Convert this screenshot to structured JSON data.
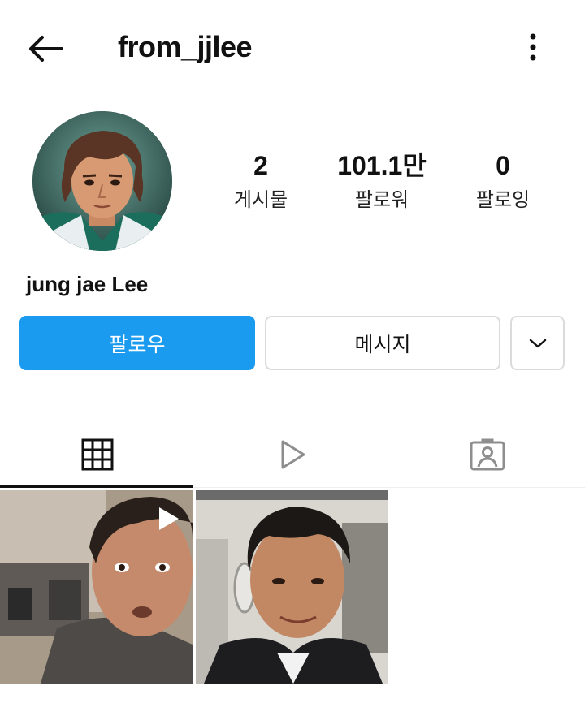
{
  "header": {
    "username": "from_jjlee",
    "back_icon": "arrow-left-icon",
    "more_icon": "vertical-ellipsis-icon"
  },
  "profile": {
    "avatar": "profile-avatar",
    "display_name": "jung jae Lee",
    "stats": [
      {
        "value": "2",
        "label": "게시물"
      },
      {
        "value": "101.1만",
        "label": "팔로워"
      },
      {
        "value": "0",
        "label": "팔로잉"
      }
    ]
  },
  "actions": {
    "follow_label": "팔로우",
    "message_label": "메시지",
    "suggest_icon": "chevron-down-icon",
    "follow_color": "#1a9bf0"
  },
  "tabs": [
    {
      "name": "grid",
      "icon": "grid-icon",
      "active": true
    },
    {
      "name": "reels",
      "icon": "play-icon",
      "active": false
    },
    {
      "name": "tagged",
      "icon": "tagged-user-icon",
      "active": false
    }
  ],
  "posts": [
    {
      "type": "video",
      "icon": "play-badge-icon"
    },
    {
      "type": "image"
    }
  ]
}
